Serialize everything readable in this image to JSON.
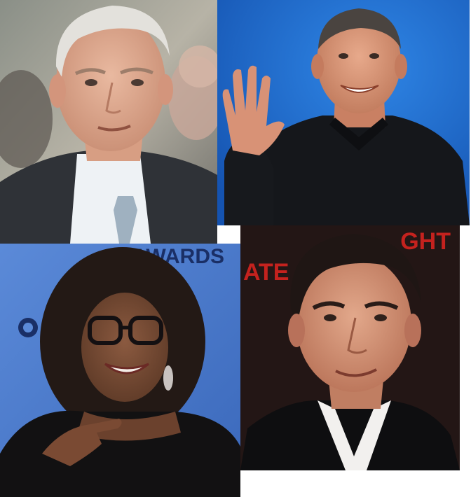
{
  "tiles": [
    {
      "id": "top-left",
      "subject": "man-in-suit"
    },
    {
      "id": "top-right",
      "subject": "man-waving"
    },
    {
      "id": "bottom-left",
      "subject": "woman-with-glasses"
    },
    {
      "id": "bottom-right",
      "subject": "man-dark-hair"
    }
  ],
  "backdrop_text": {
    "bottom_left": "AWARDS",
    "bottom_right_left": "ATE",
    "bottom_right_right": "GHT"
  },
  "colors": {
    "blue_backdrop_tr": "#1f6fd1",
    "blue_backdrop_bl": "#4f7fcf",
    "poster_red": "#c4221e",
    "poster_dark": "#231615"
  }
}
